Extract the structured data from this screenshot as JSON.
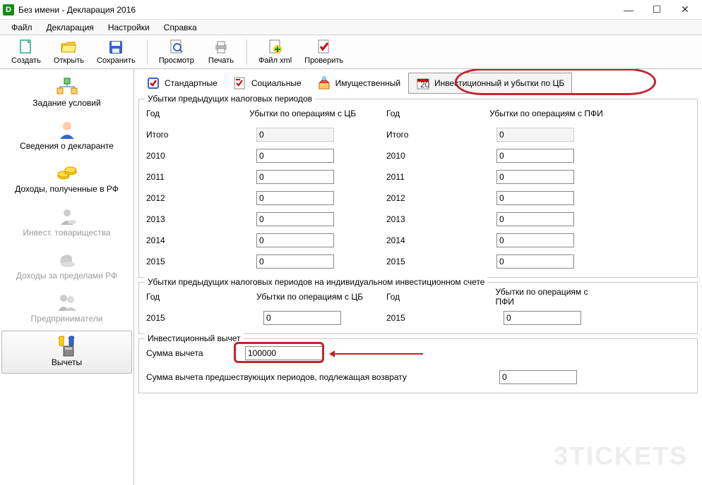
{
  "title": "Без имени - Декларация 2016",
  "menu": {
    "file": "Файл",
    "decl": "Декларация",
    "settings": "Настройки",
    "help": "Справка"
  },
  "toolbar": {
    "create": "Создать",
    "open": "Открыть",
    "save": "Сохранить",
    "preview": "Просмотр",
    "print": "Печать",
    "xml": "Файл xml",
    "check": "Проверить"
  },
  "nav": {
    "conditions": "Задание условий",
    "declarant": "Сведения о декларанте",
    "income_rf": "Доходы, полученные в РФ",
    "invest_partner": "Инвест. товарищества",
    "income_abroad": "Доходы за пределами РФ",
    "entrepreneurs": "Предприниматели",
    "deductions": "Вычеты"
  },
  "tabs": {
    "standard": "Стандартные",
    "social": "Социальные",
    "property": "Имущественный",
    "investment": "Инвестиционный и убытки по ЦБ"
  },
  "group1": {
    "title": "Убытки предыдущих налоговых периодов",
    "year_hdr": "Год",
    "cb_hdr": "Убытки по операциям с ЦБ",
    "pfi_hdr": "Убытки по операциям с ПФИ",
    "total": "Итого",
    "years": [
      "2010",
      "2011",
      "2012",
      "2013",
      "2014",
      "2015"
    ],
    "total_cb": "0",
    "total_pfi": "0",
    "vals_cb": [
      "0",
      "0",
      "0",
      "0",
      "0",
      "0"
    ],
    "vals_pfi": [
      "0",
      "0",
      "0",
      "0",
      "0",
      "0"
    ]
  },
  "group2": {
    "title": "Убытки предыдущих налоговых периодов на индивидуальном инвестиционном счете",
    "year_hdr": "Год",
    "cb_hdr": "Убытки по операциям с ЦБ",
    "pfi_hdr": "Убытки по операциям с ПФИ",
    "year": "2015",
    "val_cb": "0",
    "val_pfi": "0"
  },
  "group3": {
    "title": "Инвестиционный вычет",
    "sum_label": "Сумма вычета",
    "sum_value": "100000",
    "prev_label": "Сумма вычета предшествующих периодов, подлежащая возврату",
    "prev_value": "0"
  }
}
